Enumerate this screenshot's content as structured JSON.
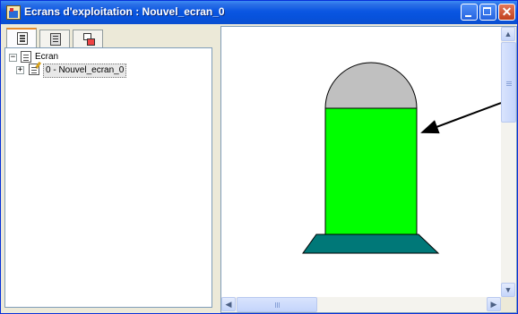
{
  "window": {
    "title": "Ecrans d'exploitation : Nouvel_ecran_0",
    "buttons": [
      "minimize",
      "maximize",
      "close"
    ]
  },
  "tabs": [
    {
      "icon": "pages-icon",
      "active": true
    },
    {
      "icon": "list-icon",
      "active": false
    },
    {
      "icon": "objects-icon",
      "active": false
    }
  ],
  "tree": {
    "root": {
      "label": "Ecran",
      "expander": "−"
    },
    "children": [
      {
        "label": "0 - Nouvel_ecran_0",
        "expander": "+"
      }
    ]
  },
  "canvas": {
    "shapes": [
      {
        "name": "silo-dome",
        "color": "#c0c0c0"
      },
      {
        "name": "silo-body",
        "color": "#00ff00"
      },
      {
        "name": "silo-base",
        "color": "#007878"
      },
      {
        "name": "pointer-arrow",
        "color": "#000000"
      }
    ]
  },
  "scrollbars": {
    "up": "▲",
    "down": "▼",
    "left": "◀",
    "right": "▶"
  },
  "colors": {
    "titlebar": "#0a56e2",
    "canvas_bg": "#ffffff",
    "selection": "#e8e8e8"
  }
}
